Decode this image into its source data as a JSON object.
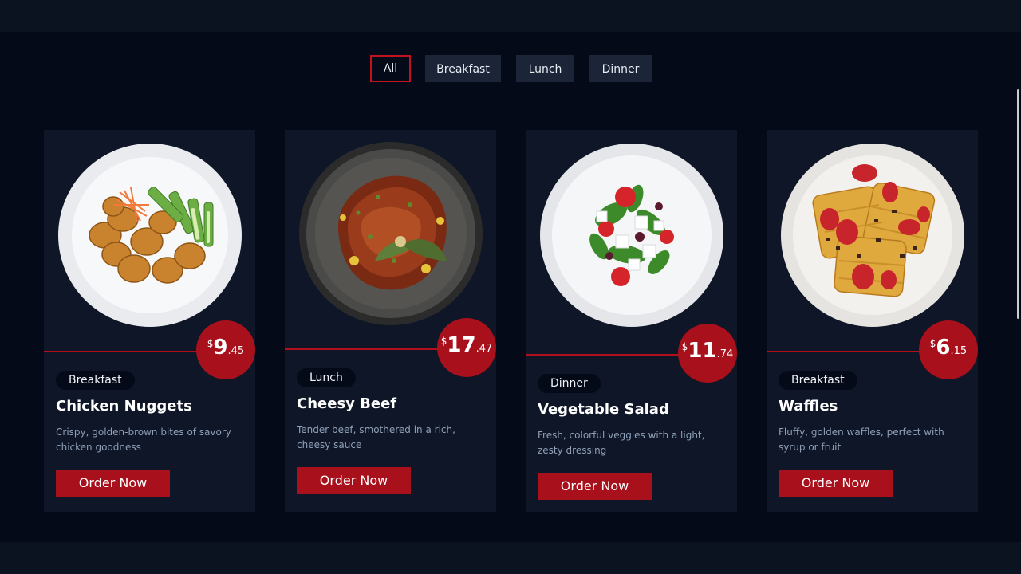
{
  "filters": [
    {
      "label": "All",
      "active": true
    },
    {
      "label": "Breakfast",
      "active": false
    },
    {
      "label": "Lunch",
      "active": false
    },
    {
      "label": "Dinner",
      "active": false
    }
  ],
  "cards": [
    {
      "category": "Breakfast",
      "title": "Chicken Nuggets",
      "price": {
        "currency": "$",
        "whole": "9",
        "cents": ".45"
      },
      "description": "Crispy, golden-brown bites of savory chicken goodness",
      "button": "Order Now",
      "image": "chicken-nuggets-plate"
    },
    {
      "category": "Lunch",
      "title": "Cheesy Beef",
      "price": {
        "currency": "$",
        "whole": "17",
        "cents": ".47"
      },
      "description": "Tender beef, smothered in a rich, cheesy sauce",
      "button": "Order Now",
      "image": "cheesy-beef-plate"
    },
    {
      "category": "Dinner",
      "title": "Vegetable Salad",
      "price": {
        "currency": "$",
        "whole": "11",
        "cents": ".74"
      },
      "description": "Fresh, colorful veggies with a light, zesty dressing",
      "button": "Order Now",
      "image": "vegetable-salad-plate"
    },
    {
      "category": "Breakfast",
      "title": "Waffles",
      "price": {
        "currency": "$",
        "whole": "6",
        "cents": ".15"
      },
      "description": "Fluffy, golden waffles, perfect with syrup or fruit",
      "button": "Order Now",
      "image": "waffles-plate"
    }
  ],
  "colors": {
    "accent": "#a8101b",
    "background": "#050a18",
    "card": "#0e1627",
    "filter": "#1c2537"
  }
}
